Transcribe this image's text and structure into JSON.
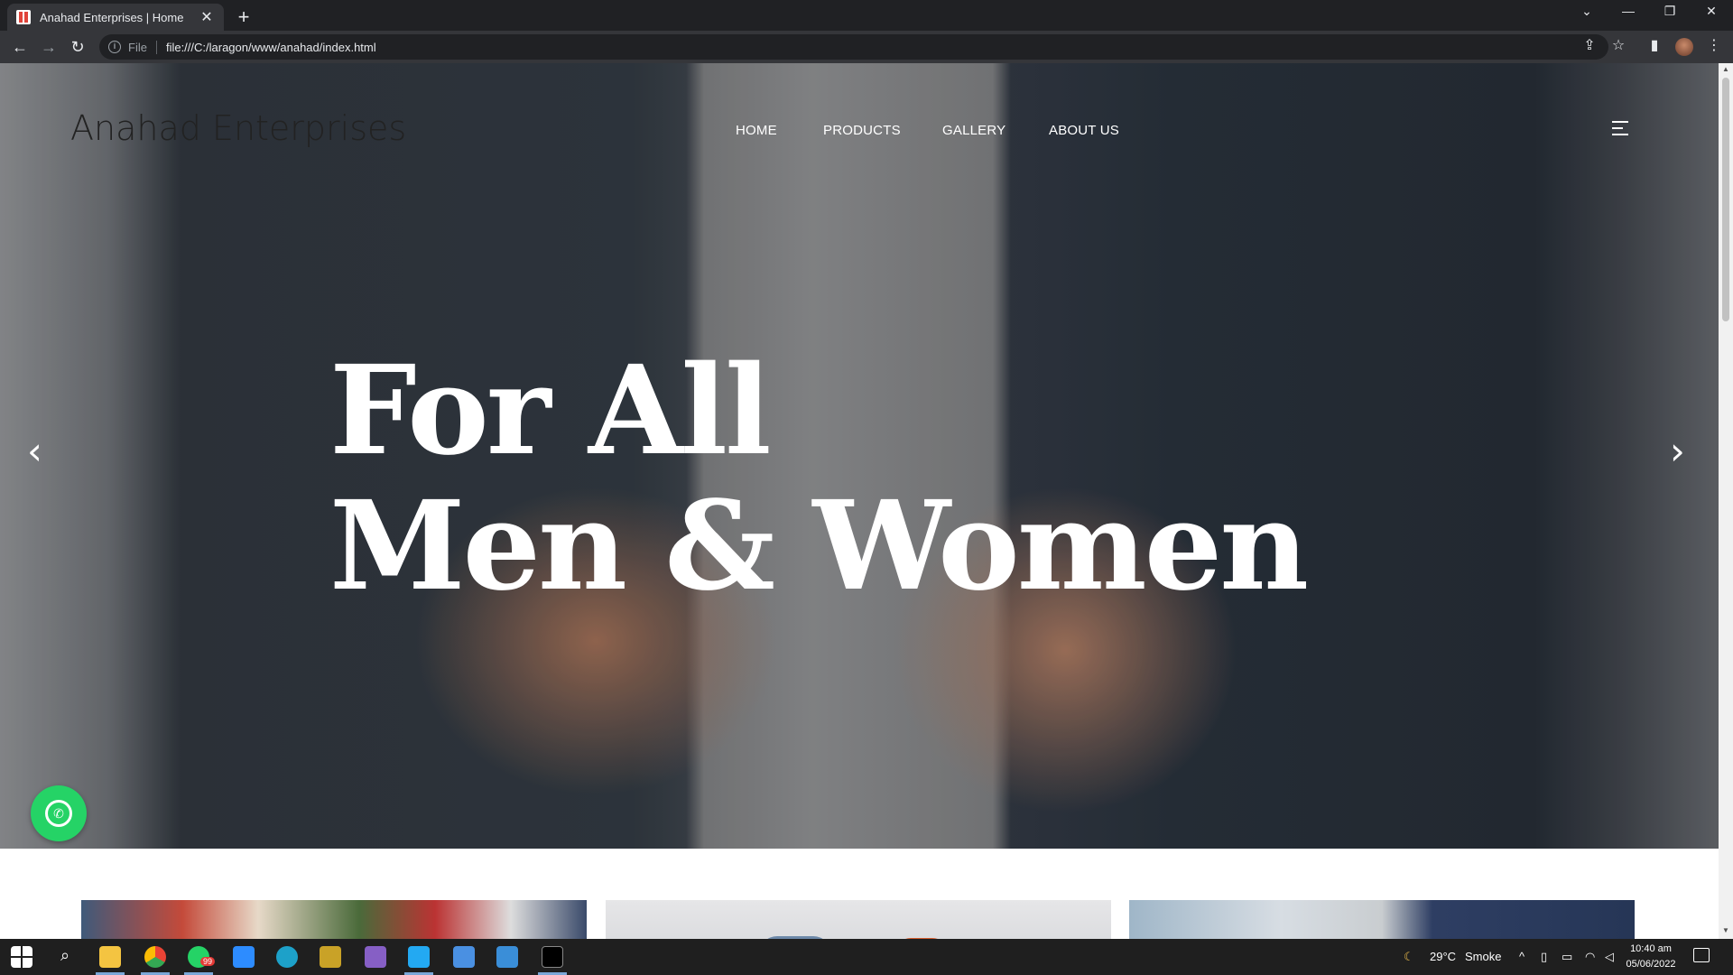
{
  "browser": {
    "tab_title": "Anahad Enterprises | Home",
    "tab_close": "✕",
    "new_tab": "+",
    "url_scheme": "File",
    "url": "file:///C:/laragon/www/anahad/index.html"
  },
  "site": {
    "brand": "Anahad Enterprises",
    "nav": [
      "HOME",
      "PRODUCTS",
      "GALLERY",
      "ABOUT US"
    ],
    "headline_line1": "For All",
    "headline_line2": "Men & Women"
  },
  "taskbar": {
    "temperature": "29°C",
    "weather": "Smoke",
    "whatsapp_badge": "99",
    "time": "10:40 am",
    "date": "05/06/2022"
  }
}
